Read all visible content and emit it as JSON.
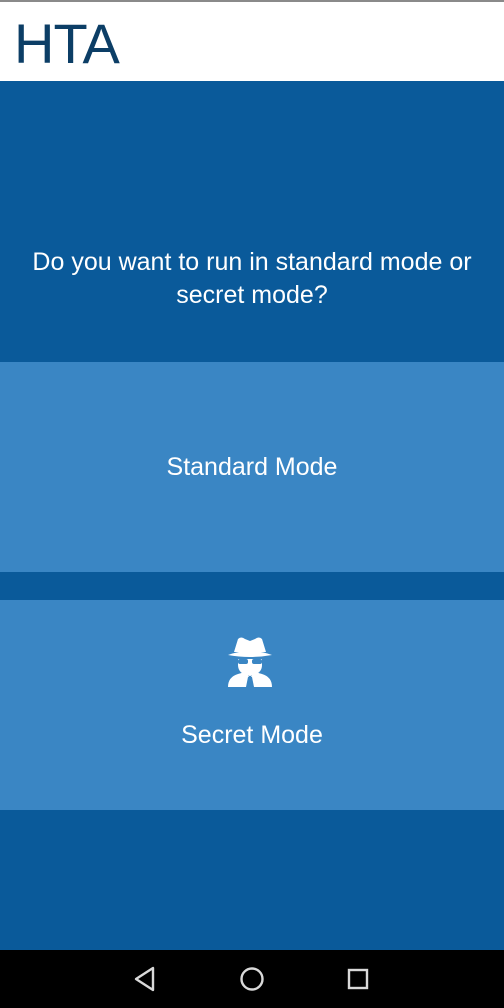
{
  "app": {
    "title": "HTA"
  },
  "prompt": {
    "question": "Do you want to run in standard mode or secret mode?"
  },
  "buttons": {
    "standard": {
      "label": "Standard Mode"
    },
    "secret": {
      "label": "Secret Mode",
      "icon": "spy-icon"
    }
  },
  "navigation": {
    "back_icon": "back-triangle-icon",
    "home_icon": "home-circle-icon",
    "recent_icon": "recent-apps-square-icon"
  },
  "colors": {
    "header_background": "#ffffff",
    "title_text": "#0c3e66",
    "main_background": "#0a5a9a",
    "button_background": "#3a86c4",
    "button_text": "#ffffff",
    "nav_background": "#000000"
  }
}
